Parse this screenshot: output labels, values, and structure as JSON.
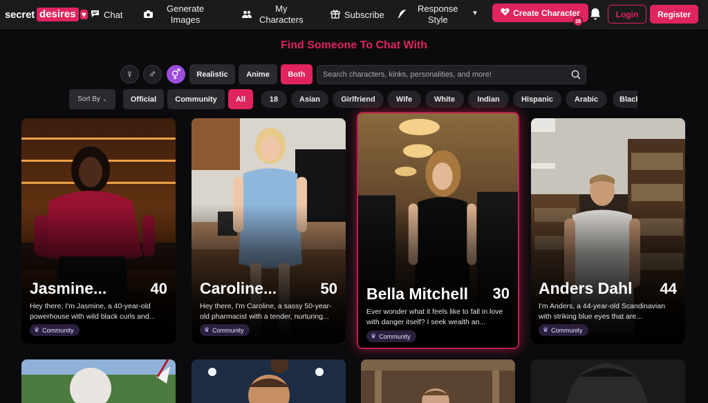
{
  "header": {
    "logo_word1": "secret",
    "logo_word2": "desires",
    "nav": {
      "chat": "Chat",
      "generate_line1": "Generate",
      "generate_line2": "Images",
      "characters_line1": "My",
      "characters_line2": "Characters",
      "subscribe": "Subscribe",
      "response_line1": "Response",
      "response_line2": "Style"
    },
    "create_label": "Create Character",
    "create_badge": "18",
    "login_label": "Login",
    "register_label": "Register"
  },
  "filters": {
    "title": "Find Someone To Chat With",
    "genders": [
      "female",
      "male",
      "both"
    ],
    "active_gender": "both",
    "styles": [
      "Realistic",
      "Anime",
      "Both"
    ],
    "active_style": "Both",
    "search_placeholder": "Search characters, kinks, personalities, and more!",
    "sort_label": "Sort By",
    "sources": [
      "Official",
      "Community"
    ],
    "tags": [
      "All",
      "18",
      "Asian",
      "Girlfriend",
      "Wife",
      "White",
      "Indian",
      "Hispanic",
      "Arabic",
      "Black"
    ],
    "active_tag": "All"
  },
  "cards": [
    {
      "name": "Jasmine...",
      "age": "40",
      "desc": "Hey there, I'm Jasmine, a 40-year-old powerhouse with wild black curls and...",
      "badge": "Community"
    },
    {
      "name": "Caroline...",
      "age": "50",
      "desc": "Hey there, I'm Caroline, a sassy 50-year-old pharmacist with a tender, nurturing...",
      "badge": "Community"
    },
    {
      "name": "Bella Mitchell",
      "age": "30",
      "desc": "Ever wonder what it feels like to fall in love with danger itself? I seek wealth an...",
      "badge": "Community"
    },
    {
      "name": "Anders Dahl",
      "age": "44",
      "desc": "I'm Anders, a 44-year-old Scandinavian with striking blue eyes that are...",
      "badge": "Community"
    }
  ],
  "colors": {
    "accent": "#e0245e",
    "gender_active": "#9b4ddb",
    "bg": "#0b0b0d",
    "header": "#1b1b1e"
  },
  "icons": [
    "chat-icon",
    "camera-icon",
    "users-icon",
    "gift-icon",
    "feather-icon",
    "heart-icon",
    "bell-icon",
    "search-icon",
    "female-icon",
    "male-icon",
    "both-gender-icon",
    "crown-icon"
  ]
}
